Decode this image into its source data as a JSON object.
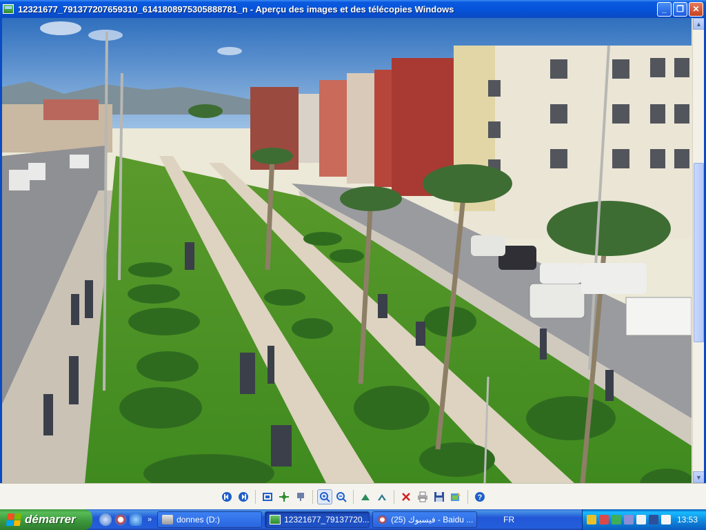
{
  "window": {
    "title": "12321677_791377207659310_6141808975305888781_n - Aperçu des images et des télécopies Windows",
    "minimize": "_",
    "maximize": "❐",
    "close": "✕"
  },
  "toolbar": {
    "buttons": [
      {
        "name": "previous-image-button",
        "icon": "previous-icon"
      },
      {
        "name": "next-image-button",
        "icon": "next-icon"
      },
      {
        "name": "best-fit-button",
        "icon": "best-fit-icon"
      },
      {
        "name": "actual-size-button",
        "icon": "actual-size-icon"
      },
      {
        "name": "slideshow-button",
        "icon": "slideshow-icon"
      },
      {
        "name": "zoom-in-button",
        "icon": "zoom-in-icon"
      },
      {
        "name": "zoom-out-button",
        "icon": "zoom-out-icon"
      },
      {
        "name": "rotate-clockwise-button",
        "icon": "rotate-clockwise-icon"
      },
      {
        "name": "rotate-counterclockwise-button",
        "icon": "rotate-counterclockwise-icon"
      },
      {
        "name": "delete-button",
        "icon": "delete-icon"
      },
      {
        "name": "print-button",
        "icon": "print-icon"
      },
      {
        "name": "save-button",
        "icon": "save-icon"
      },
      {
        "name": "edit-button",
        "icon": "edit-icon"
      },
      {
        "name": "help-button",
        "icon": "help-icon"
      }
    ],
    "accent": "#1f5fc8"
  },
  "taskbar": {
    "start_label": "démarrer",
    "tasks": [
      {
        "label": "donnes (D:)",
        "icon": "drive-icon"
      },
      {
        "label": "12321677_79137720...",
        "icon": "image-viewer-icon"
      },
      {
        "label": "(25) فيسبوك - Baidu ...",
        "icon": "browser-icon"
      }
    ],
    "language": "FR",
    "clock": "13:53"
  }
}
